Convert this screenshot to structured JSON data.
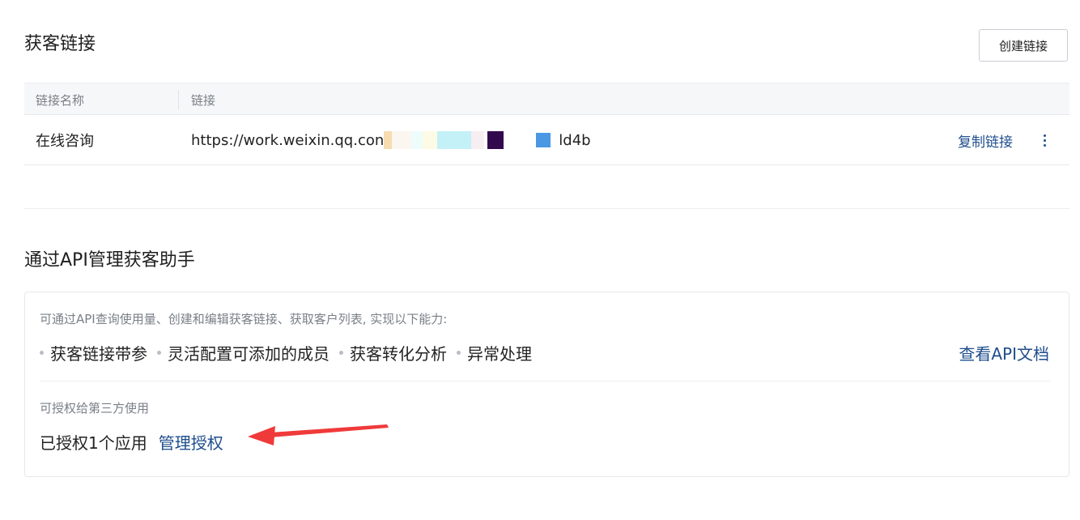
{
  "links_section": {
    "title": "获客链接",
    "create_button_label": "创建链接",
    "columns": [
      "链接名称",
      "链接"
    ],
    "rows": [
      {
        "name": "在线咨询",
        "url_prefix": "https://work.weixin.qq.con",
        "url_suffix": "ld4b",
        "copy_label": "复制链接"
      }
    ]
  },
  "api_section": {
    "title": "通过API管理获客助手",
    "description": "可通过API查询使用量、创建和编辑获客链接、获取客户列表, 实现以下能力:",
    "capabilities": [
      "获客链接带参",
      "灵活配置可添加的成员",
      "获客转化分析",
      "异常处理"
    ],
    "doc_link_label": "查看API文档",
    "third_party_label": "可授权给第三方使用",
    "authorized_text": "已授权1个应用",
    "manage_auth_label": "管理授权"
  },
  "colors": {
    "link_blue": "#1f4e8c",
    "annotation_arrow": "#f03a3a"
  }
}
